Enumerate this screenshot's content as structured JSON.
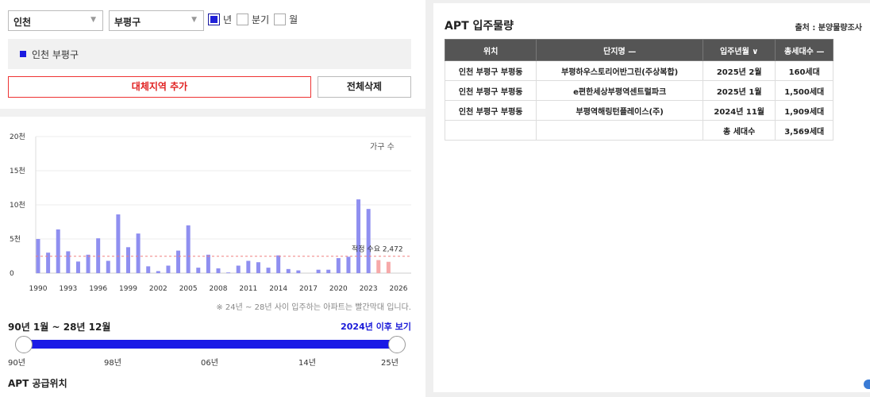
{
  "filters": {
    "city": "인천",
    "district": "부평구",
    "period_options": [
      {
        "label": "년",
        "checked": true
      },
      {
        "label": "분기",
        "checked": false
      },
      {
        "label": "월",
        "checked": false
      }
    ]
  },
  "region_selected": "인천 부평구",
  "buttons": {
    "add_region": "대체지역 추가",
    "delete_all": "전체삭제"
  },
  "chart_data": {
    "type": "bar",
    "series_label": "가구 수",
    "y_ticks": [
      "0",
      "5천",
      "10천",
      "15천",
      "20천"
    ],
    "ylim": [
      0,
      20000
    ],
    "x_tick_labels": [
      "1990",
      "1993",
      "1996",
      "1999",
      "2002",
      "2005",
      "2008",
      "2011",
      "2014",
      "2017",
      "2020",
      "2023",
      "2026"
    ],
    "x": [
      1990,
      1991,
      1992,
      1993,
      1994,
      1995,
      1996,
      1997,
      1998,
      1999,
      2000,
      2001,
      2002,
      2003,
      2004,
      2005,
      2006,
      2007,
      2008,
      2009,
      2010,
      2011,
      2012,
      2013,
      2014,
      2015,
      2016,
      2017,
      2018,
      2019,
      2020,
      2021,
      2022,
      2023,
      2024,
      2025
    ],
    "values": [
      5000,
      3000,
      6400,
      3200,
      1700,
      2700,
      5100,
      1800,
      8600,
      3800,
      5800,
      1000,
      300,
      1100,
      3300,
      7000,
      800,
      2700,
      700,
      100,
      1100,
      1800,
      1600,
      800,
      2600,
      600,
      400,
      0,
      500,
      500,
      2200,
      2400,
      10800,
      9400,
      1909,
      1660
    ],
    "highlight_from": 2024,
    "colors": {
      "normal": "#8f8ff0",
      "future": "#f6a9a9",
      "threshold": "#f08080"
    },
    "threshold": {
      "label": "적정 수요 2,472",
      "value": 2472
    }
  },
  "note": "※ 24년 ~ 28년 사이 입주하는 아파트는 빨간막대 입니다.",
  "range": {
    "label": "90년 1월 ~ 28년 12월",
    "after_link": "2024년 이후 보기",
    "ticks": [
      "90년",
      "98년",
      "06년",
      "14년",
      "25년"
    ]
  },
  "supply_title": "APT 공급위치",
  "right_panel": {
    "title": "APT 입주물량",
    "source": "출처 : 분양물량조사",
    "headers": [
      "위치",
      "단지명 —",
      "입주년월 ∨",
      "총세대수 —"
    ],
    "rows": [
      [
        "인천 부평구 부평동",
        "부평하우스토리어반그린(주상복합)",
        "2025년 2월",
        "160세대"
      ],
      [
        "인천 부평구 부평동",
        "e편한세상부평역센트럴파크",
        "2025년 1월",
        "1,500세대"
      ],
      [
        "인천 부평구 부평동",
        "부평역해링턴플레이스(주)",
        "2024년 11월",
        "1,909세대"
      ]
    ],
    "total_label": "총 세대수",
    "total_value": "3,569세대"
  }
}
